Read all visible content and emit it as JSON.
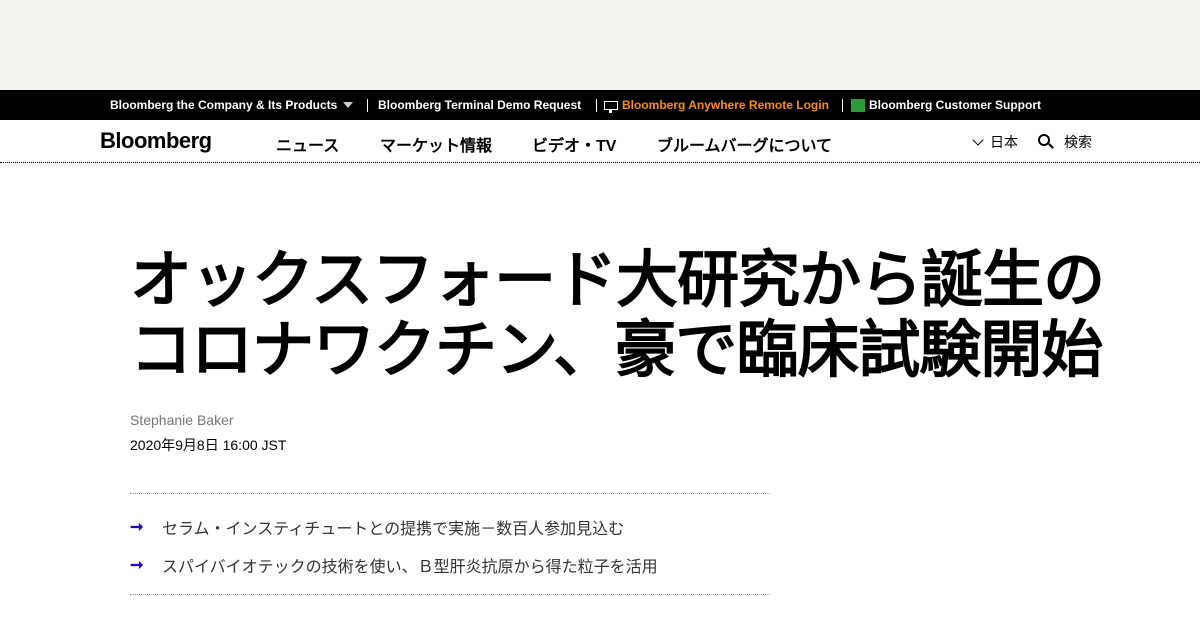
{
  "topbar": {
    "company_products": "Bloomberg the Company & Its Products",
    "terminal_demo": "Bloomberg Terminal Demo Request",
    "anywhere_login": "Bloomberg Anywhere Remote Login",
    "customer_support": "Bloomberg Customer Support"
  },
  "nav": {
    "logo": "Bloomberg",
    "items": [
      "ニュース",
      "マーケット情報",
      "ビデオ・TV",
      "ブルームバーグについて"
    ],
    "language": "日本",
    "search": "検索"
  },
  "article": {
    "headline_line1": "オックスフォード大研究から誕生の",
    "headline_line2": "コロナワクチン、豪で臨床試験開始",
    "author": "Stephanie Baker",
    "date": "2020年9月8日 16:00 JST",
    "bullets": [
      "セラム・インスティチュートとの提携で実施－数百人参加見込む",
      "スパイバイオテックの技術を使い、Ｂ型肝炎抗原から得た粒子を活用"
    ],
    "arrow_glyph": "➞"
  },
  "colors": {
    "topbar_bg": "#000000",
    "anywhere_orange": "#fb8b1e",
    "arrow_blue": "#2800d7",
    "ad_band": "#f2f2ef"
  }
}
